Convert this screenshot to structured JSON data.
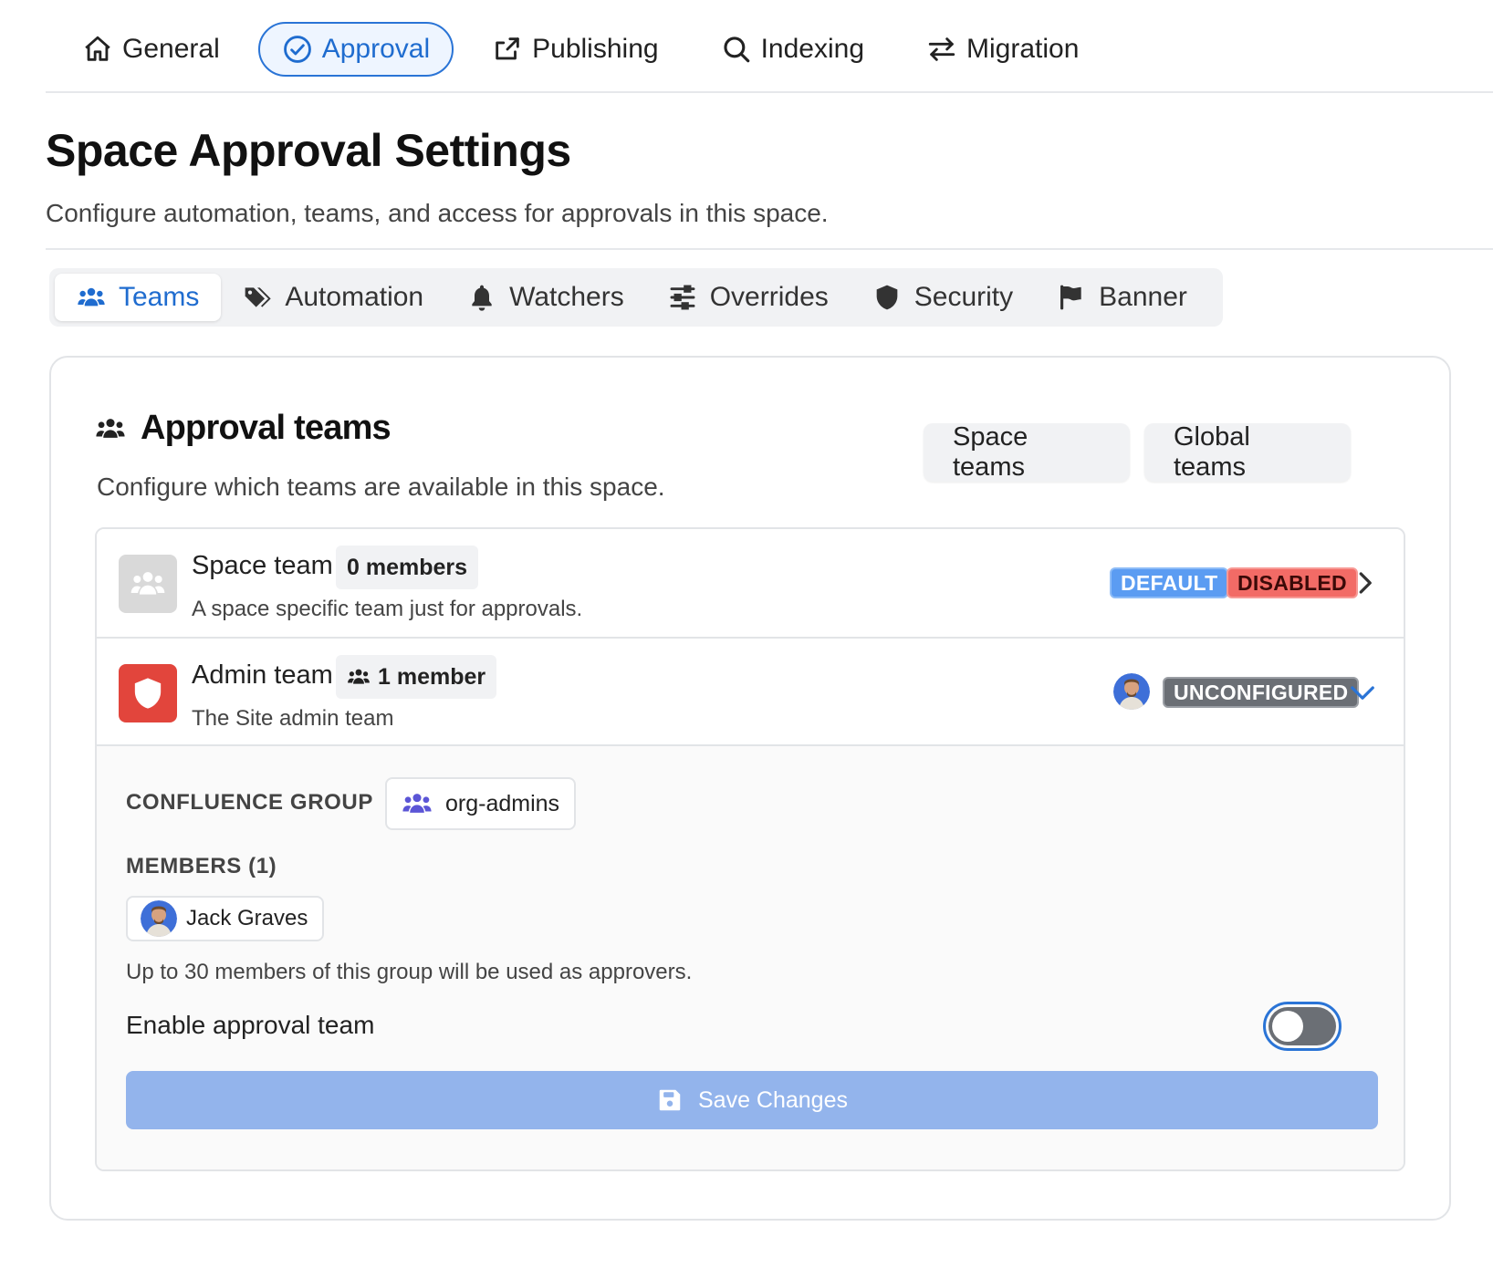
{
  "top_nav": {
    "items": [
      {
        "label": "General",
        "icon": "home-icon",
        "active": false
      },
      {
        "label": "Approval",
        "icon": "check-circle-icon",
        "active": true
      },
      {
        "label": "Publishing",
        "icon": "share-icon",
        "active": false
      },
      {
        "label": "Indexing",
        "icon": "search-icon",
        "active": false
      },
      {
        "label": "Migration",
        "icon": "swap-arrows-icon",
        "active": false
      }
    ]
  },
  "page": {
    "title": "Space Approval Settings",
    "subtitle": "Configure automation, teams, and access for approvals in this space."
  },
  "sub_tabs": {
    "items": [
      {
        "label": "Teams",
        "icon": "users-icon",
        "active": true
      },
      {
        "label": "Automation",
        "icon": "tags-icon",
        "active": false
      },
      {
        "label": "Watchers",
        "icon": "bell-icon",
        "active": false
      },
      {
        "label": "Overrides",
        "icon": "sliders-icon",
        "active": false
      },
      {
        "label": "Security",
        "icon": "shield-icon",
        "active": false
      },
      {
        "label": "Banner",
        "icon": "flag-icon",
        "active": false
      }
    ]
  },
  "approval_teams": {
    "title": "Approval teams",
    "subtitle": "Configure which teams are available in this space.",
    "space_teams_label": "Space teams",
    "global_teams_label": "Global teams",
    "teams": [
      {
        "name": "Space team",
        "count": "0 members",
        "description": "A space specific team just for approvals.",
        "badges": [
          "DEFAULT",
          "DISABLED"
        ]
      },
      {
        "name": "Admin team",
        "count": "1 member",
        "description": "The Site admin team",
        "badges": [
          "UNCONFIGURED"
        ]
      }
    ],
    "details": {
      "group_label": "CONFLUENCE GROUP",
      "group_value": "org-admins",
      "members_label": "MEMBERS (1)",
      "member_name": "Jack Graves",
      "note": "Up to 30 members of this group will be used as approvers.",
      "toggle_label": "Enable approval team",
      "toggle_on": false,
      "save_label": "Save Changes"
    }
  },
  "colors": {
    "accent": "#2a74d6",
    "default_badge_bg": "#5b9cf2",
    "disabled_badge_bg": "#f26b66",
    "unconfigured_badge_bg": "#6b6f75",
    "admin_team_red": "#e2453c",
    "save_button_bg": "#93b4ec"
  }
}
